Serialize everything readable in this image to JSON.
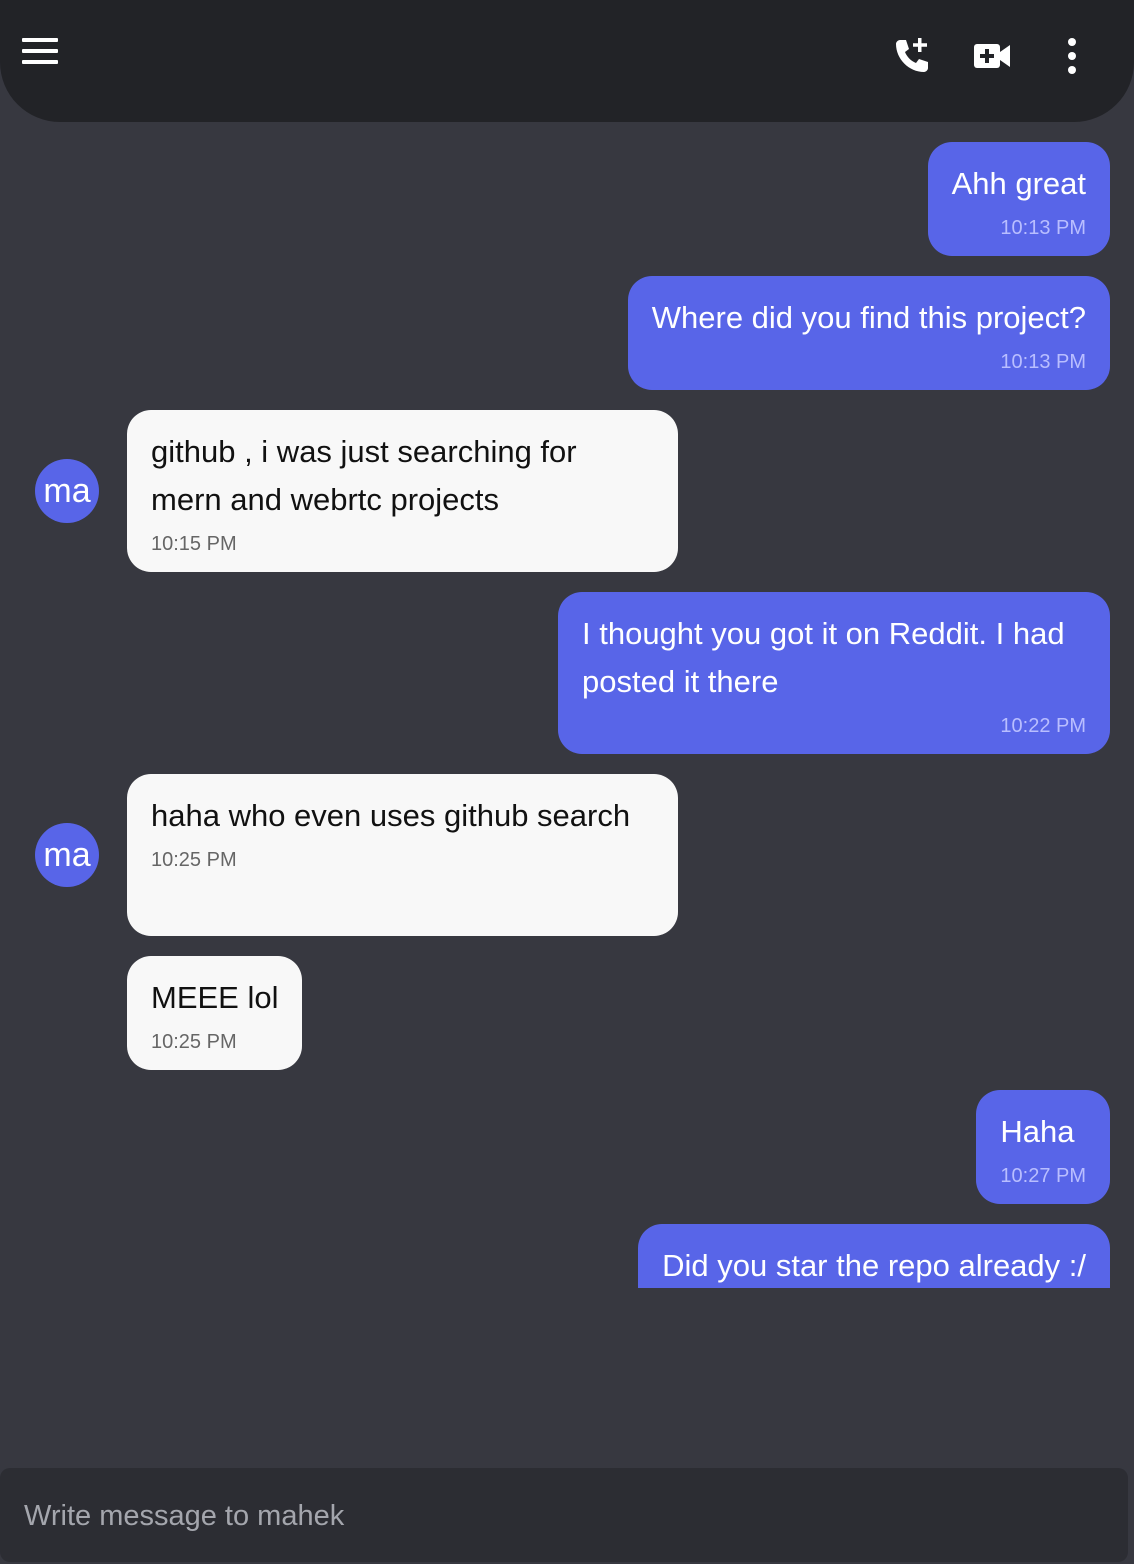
{
  "header": {
    "menu_icon": "hamburger-menu-icon",
    "add_call_icon": "phone-plus-icon",
    "video_call_icon": "video-plus-icon",
    "more_icon": "more-vertical-icon"
  },
  "contact": {
    "avatar_initials": "ma"
  },
  "messages": [
    {
      "direction": "outgoing",
      "text": "Ahh great",
      "time": "10:13 PM"
    },
    {
      "direction": "outgoing",
      "text": "Where did you find this project?",
      "time": "10:13 PM"
    },
    {
      "direction": "incoming",
      "text": "github , i was just searching for mern and webrtc projects",
      "time": "10:15 PM"
    },
    {
      "direction": "outgoing",
      "text": "I thought you got it on Reddit. I had posted it there",
      "time": "10:22 PM"
    },
    {
      "direction": "incoming",
      "text": "haha who even uses github search",
      "time": "10:25 PM"
    },
    {
      "direction": "incoming",
      "text": "MEEE lol",
      "time": "10:25 PM"
    },
    {
      "direction": "outgoing",
      "text": "Haha",
      "time": "10:27 PM"
    },
    {
      "direction": "outgoing",
      "text": "Did you star the repo already :/",
      "time": ""
    }
  ],
  "composer": {
    "placeholder": "Write message to mahek",
    "value": ""
  },
  "colors": {
    "background": "#373840",
    "header": "#222327",
    "outgoing_bubble": "#5865e8",
    "incoming_bubble": "#f8f8f8",
    "avatar": "#5865e8",
    "composer": "#2c2d33"
  }
}
